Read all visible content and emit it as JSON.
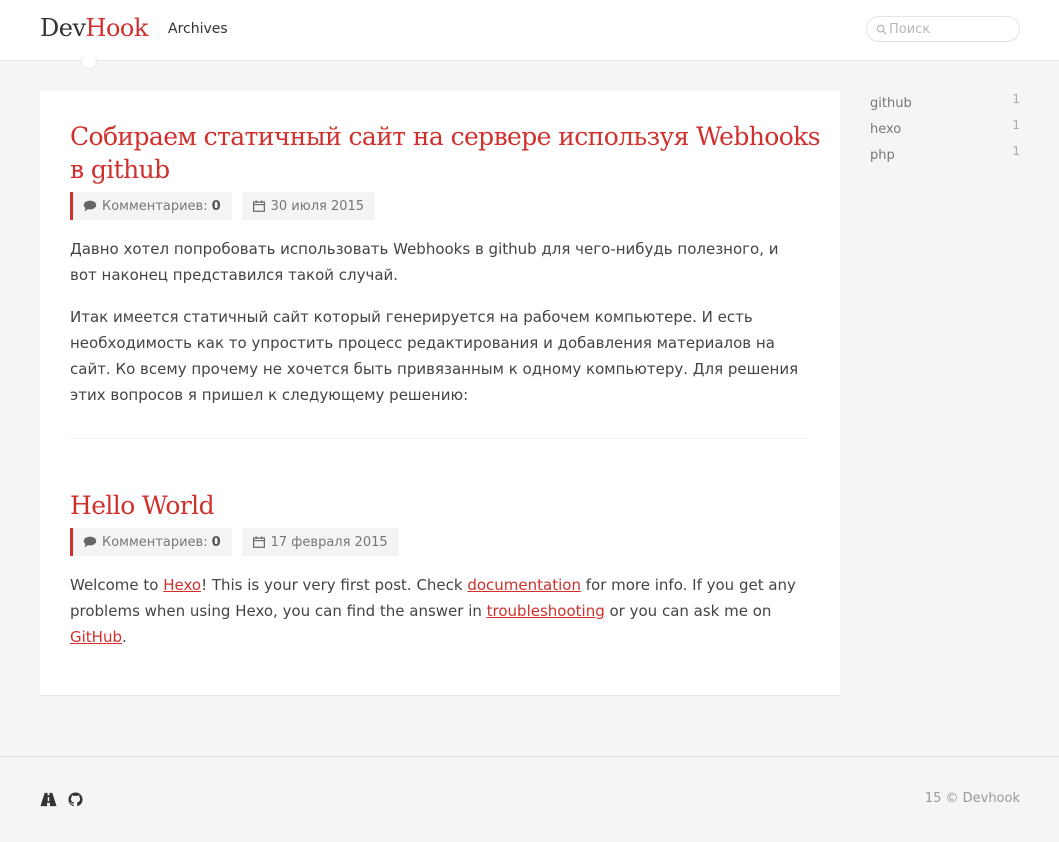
{
  "header": {
    "logo_dev": "Dev",
    "logo_hook": "Hook",
    "nav_archives": "Archives",
    "search_placeholder": "Поиск",
    "search_value": ""
  },
  "posts": [
    {
      "title": "Собираем статичный сайт на сервере используя Webhooks в github",
      "comments_label": "Комментариев:",
      "comments_count": "0",
      "date": "30 июля 2015",
      "paragraphs": [
        "Давно хотел попробовать использовать Webhooks в github для чего-нибудь полезного, и вот наконец представился такой случай.",
        "Итак имеется статичный сайт который генерируется на рабочем компьютере. И есть необходимость как то упростить процесс редактирования и добавления материалов на сайт. Ко всему прочему не хочется быть привязанным к одному компьютеру. Для решения этих вопросов я пришел к следующему решению:"
      ]
    },
    {
      "title": "Hello World",
      "comments_label": "Комментариев:",
      "comments_count": "0",
      "date": "17 февраля 2015",
      "body": {
        "t1": "Welcome to ",
        "link_hexo": "Hexo",
        "t2": "! This is your very first post. Check ",
        "link_documentation": "documentation",
        "t3": " for more info. If you get any problems when using Hexo, you can find the answer in ",
        "link_troubleshooting": "troubleshooting",
        "t4": " or you can ask me on ",
        "link_github": "GitHub",
        "t5": "."
      }
    }
  ],
  "tags": [
    {
      "name": "github",
      "count": "1"
    },
    {
      "name": "hexo",
      "count": "1"
    },
    {
      "name": "php",
      "count": "1"
    }
  ],
  "footer": {
    "icons": [
      "road-icon",
      "github-icon"
    ],
    "copyright": "15 © Devhook"
  },
  "colors": {
    "accent": "#d0312d",
    "background": "#f4f5f6",
    "card": "#ffffff"
  }
}
